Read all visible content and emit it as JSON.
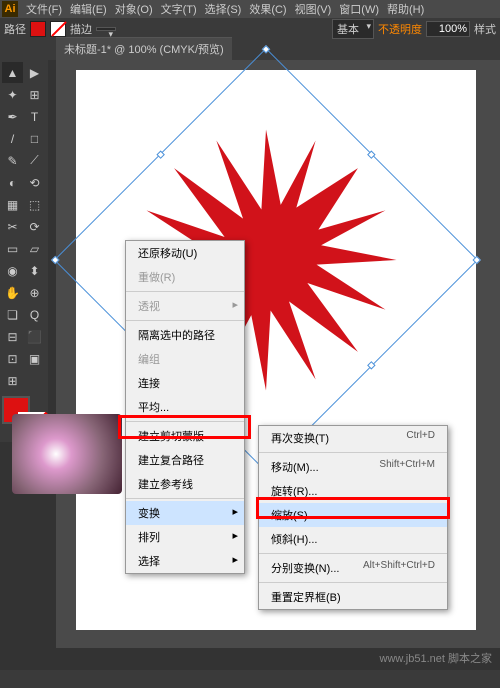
{
  "menubar": {
    "items": [
      "文件(F)",
      "编辑(E)",
      "对象(O)",
      "文字(T)",
      "选择(S)",
      "效果(C)",
      "视图(V)",
      "窗口(W)",
      "帮助(H)"
    ]
  },
  "control": {
    "path_label": "路径",
    "stroke_label": "描边",
    "stroke_weight": "",
    "basic": "基本",
    "opacity_label": "不透明度",
    "opacity_value": "100%",
    "style_label": "样式"
  },
  "tab": {
    "title": "未标题-1* @ 100% (CMYK/预览)"
  },
  "tools": [
    "▲",
    "▶",
    "✦",
    "⊞",
    "T",
    "/",
    "□",
    "✎",
    "⟋",
    "◐",
    "⟲",
    "▦",
    "⬚",
    "✂",
    "⟳",
    "▭",
    "▱",
    "◉",
    "⬍",
    "✋",
    "⊕",
    "❏",
    "Q",
    "⊟",
    "⬛",
    "⊡",
    "▣",
    "⊞"
  ],
  "ctx1": {
    "undo": "还原移动(U)",
    "redo": "重做(R)",
    "perspective": "透视",
    "isolate": "隔离选中的路径",
    "group": "编组",
    "join": "连接",
    "average": "平均...",
    "clip": "建立剪切蒙版",
    "compound": "建立复合路径",
    "guides": "建立参考线",
    "transform": "变换",
    "arrange": "排列",
    "select": "选择"
  },
  "ctx2": {
    "again": {
      "l": "再次变换(T)",
      "s": "Ctrl+D"
    },
    "move": {
      "l": "移动(M)...",
      "s": "Shift+Ctrl+M"
    },
    "rotate": {
      "l": "旋转(R)...",
      "s": ""
    },
    "scale": {
      "l": "缩放(S)...",
      "s": ""
    },
    "shear": {
      "l": "倾斜(H)...",
      "s": ""
    },
    "each": {
      "l": "分别变换(N)...",
      "s": "Alt+Shift+Ctrl+D"
    },
    "reset": {
      "l": "重置定界框(B)",
      "s": ""
    }
  },
  "watermark": "www.jb51.net 脚本之家"
}
